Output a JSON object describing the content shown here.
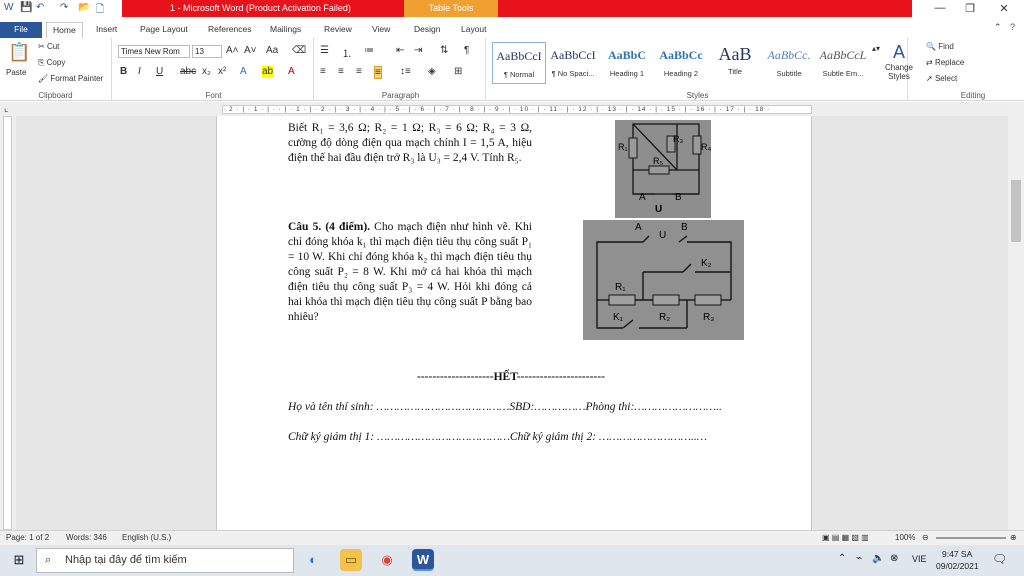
{
  "window": {
    "title": "1 - Microsoft Word (Product Activation Failed)",
    "contextual_tab": "Table Tools"
  },
  "tabs": [
    "File",
    "Home",
    "Insert",
    "Page Layout",
    "References",
    "Mailings",
    "Review",
    "View",
    "Design",
    "Layout"
  ],
  "clipboard": {
    "paste": "Paste",
    "cut": "Cut",
    "copy": "Copy",
    "format_painter": "Format Painter",
    "label": "Clipboard"
  },
  "font": {
    "name": "Times New Rom",
    "size": "13",
    "label": "Font"
  },
  "paragraph": {
    "label": "Paragraph"
  },
  "styles": {
    "items": [
      {
        "sample": "AaBbCcI",
        "name": "¶ Normal"
      },
      {
        "sample": "AaBbCcI",
        "name": "¶ No Spaci..."
      },
      {
        "sample": "AaBbC",
        "name": "Heading 1"
      },
      {
        "sample": "AaBbCc",
        "name": "Heading 2"
      },
      {
        "sample": "AaB",
        "name": "Title"
      },
      {
        "sample": "AaBbCc.",
        "name": "Subtitle"
      },
      {
        "sample": "AaBbCcL",
        "name": "Subtle Em..."
      }
    ],
    "change_styles": "Change Styles",
    "label": "Styles"
  },
  "editing": {
    "find": "Find",
    "replace": "Replace",
    "select": "Select",
    "label": "Editing"
  },
  "ruler_text": "· 2 · | · 1 · | ·  · | · 1 · | · 2 · | · 3 · | · 4 · | · 5 · | · 6 · | · 7 · | · 8 · | · 9 · | · 10 · | · 11 · | · 12 · | · 13 · | · 14 · | · 15 · | · 16 · | · 17 · | · 18 ·",
  "document": {
    "para1": "Biết R₁ = 3,6 Ω; R₂ = 1 Ω; R₃ = 6 Ω; R₄ = 3 Ω, cường độ dòng điện qua mạch chính I = 1,5 A, hiệu điện thế hai đầu điện trở R₃ là U₃ = 2,4 V. Tính R₅.",
    "q5_label": "Câu 5. (4 điểm).",
    "q5_text": " Cho mạch điện như hình vẽ. Khi chỉ đóng khóa k₁ thì mạch điện tiêu thụ công suất P₁ = 10 W. Khi chỉ đóng khóa k₂ thì mạch điện tiêu thụ công suất P₂ = 8 W. Khi mở cả hai khóa thì mạch điện tiêu thụ công suất P₃ = 4 W. Hỏi khi đóng cả hai khóa thì mạch điện tiêu thụ công suất P bằng bao nhiêu?",
    "end_mark": "--------------------HẾT-----------------------",
    "name_line": "Họ và tên thí sinh: …………………………………SBD:……………Phòng thi:……………………..",
    "sign_line": "Chữ ký giám thị 1: …………………………………Chữ ký giám thị 2: ………………………..…",
    "fig1_labels": [
      "R₁",
      "R₃",
      "R₄",
      "R₅",
      "A",
      "U",
      "B"
    ],
    "fig2_labels": [
      "A",
      "U",
      "B",
      "K₂",
      "R₁",
      "K₁",
      "R₂",
      "R₃"
    ]
  },
  "status": {
    "page": "Page: 1 of 2",
    "words": "Words: 346",
    "language": "English (U.S.)",
    "zoom": "100%"
  },
  "taskbar": {
    "search_placeholder": "Nhập tại đây để tìm kiếm",
    "lang": "VIE",
    "time": "9:47 SA",
    "date": "09/02/2021"
  }
}
